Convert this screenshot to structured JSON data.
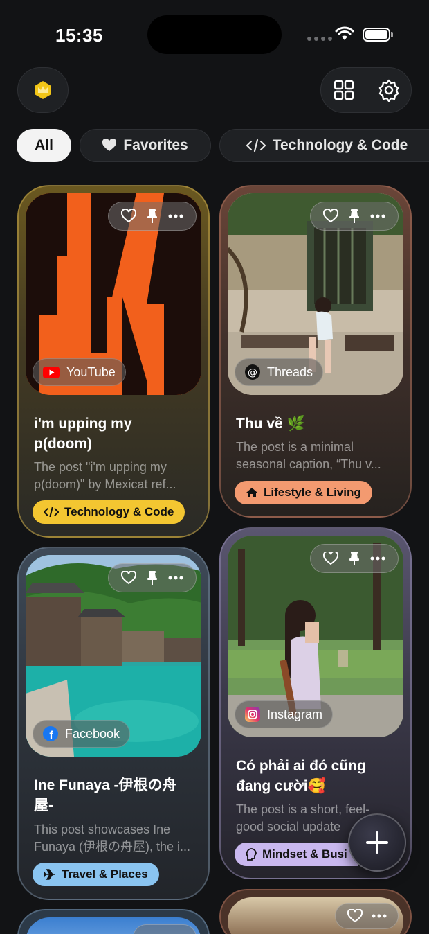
{
  "status_bar": {
    "time": "15:35"
  },
  "filters": [
    {
      "label": "All"
    },
    {
      "label": "Favorites"
    },
    {
      "label": "Technology & Code"
    }
  ],
  "cards": [
    {
      "source": "YouTube",
      "title": "i'm upping my p(doom)",
      "description": "The post \"i'm upping my p(doom)\" by Mexicat ref...",
      "tag": "Technology & Code",
      "tag_color": "#f3c631"
    },
    {
      "source": "Threads",
      "title": "Thu về 🌿",
      "description": "The post is a minimal seasonal caption, “Thu v...",
      "tag": "Lifestyle & Living",
      "tag_color": "#f39a70"
    },
    {
      "source": "Facebook",
      "title": "Ine Funaya -伊根の舟屋-",
      "description": "This post showcases Ine Funaya (伊根の舟屋), the i...",
      "tag": "Travel & Places",
      "tag_color": "#8ac4f0"
    },
    {
      "source": "Instagram",
      "title": "Có phải ai đó cũng đang cười🥰",
      "description": "The post is a short, feel-good social update",
      "tag": "Mindset & Busi",
      "tag_color": "#c9b8ef"
    }
  ],
  "colors": {
    "background": "#121315",
    "accent_yellow": "#f3c631"
  }
}
